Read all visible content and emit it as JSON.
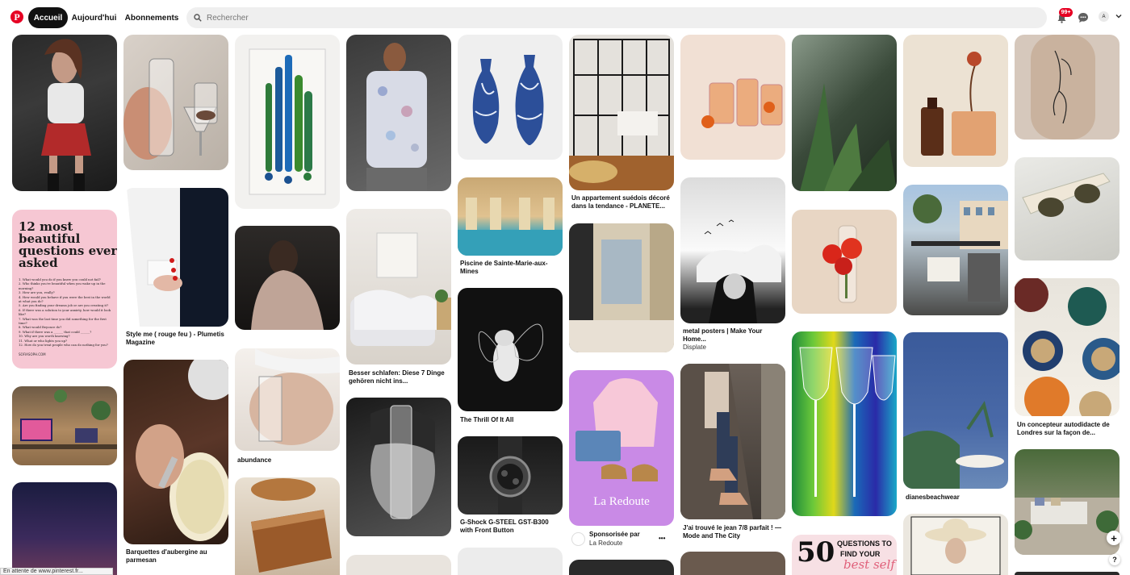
{
  "header": {
    "logo": "P",
    "nav": {
      "home": "Accueil",
      "today": "Aujourd'hui",
      "following": "Abonnements"
    },
    "search": {
      "placeholder": "Rechercher",
      "value": ""
    },
    "notifications_badge": "99+",
    "avatar_initial": "A"
  },
  "pins": {
    "style_me": "Style me ( rouge feu ) - Plumetis Magazine",
    "barquettes": "Barquettes d'aubergine au parmesan",
    "abundance": "abundance",
    "besser": "Besser schlafen: Diese 7 Dinge gehören nicht ins...",
    "piscine": "Piscine de Sainte-Marie-aux-Mines",
    "thrill": "The Thrill Of It All",
    "gshock": "G-Shock G-STEEL GST-B300 with Front Button",
    "appartement": "Un appartement suédois décoré dans la tendance - PLANETE...",
    "sponsor_label": "Sponsorisée par",
    "sponsor_name": "La Redoute",
    "redoute_logo": "La Redoute",
    "metal_posters": "metal posters | Make Your Home...",
    "displate": "Displate",
    "jean": "J'ai trouvé le jean 7/8 parfait ! — Mode and The City",
    "dianes": "dianesbeachwear",
    "concepteur": "Un concepteur autodidacte de Londres sur la façon de..."
  },
  "questions_pin": {
    "title": "12 most beautiful questions ever asked",
    "lines": [
      "1. What would you do if you knew you could not fail?",
      "2. Who thinks you're beautiful when you wake up in the morning?",
      "3. How are you, really?",
      "4. How would you behave if you were the best in the world at what you do?",
      "5. Are you finding your dreams job or are you creating it?",
      "6. If there was a solution to your anxiety, how would it look like?",
      "7. What was the last time you did something for the first time?",
      "8. What would Beyonce do?",
      "9. What if there was a ______ that could ______?",
      "10. Why are you worth knowing?",
      "11. What or who lights you up?",
      "12. How do you treat people who can do nothing for you?"
    ],
    "footer": "SOFIASOPH.COM"
  },
  "fifty_pin": {
    "number": "50",
    "line1": "QUESTIONS TO",
    "line2": "FIND YOUR",
    "script": "best self"
  },
  "more_button": "•••",
  "fab": "+",
  "help": "?",
  "status_bar": "En attente de www.pinterest.fr..."
}
